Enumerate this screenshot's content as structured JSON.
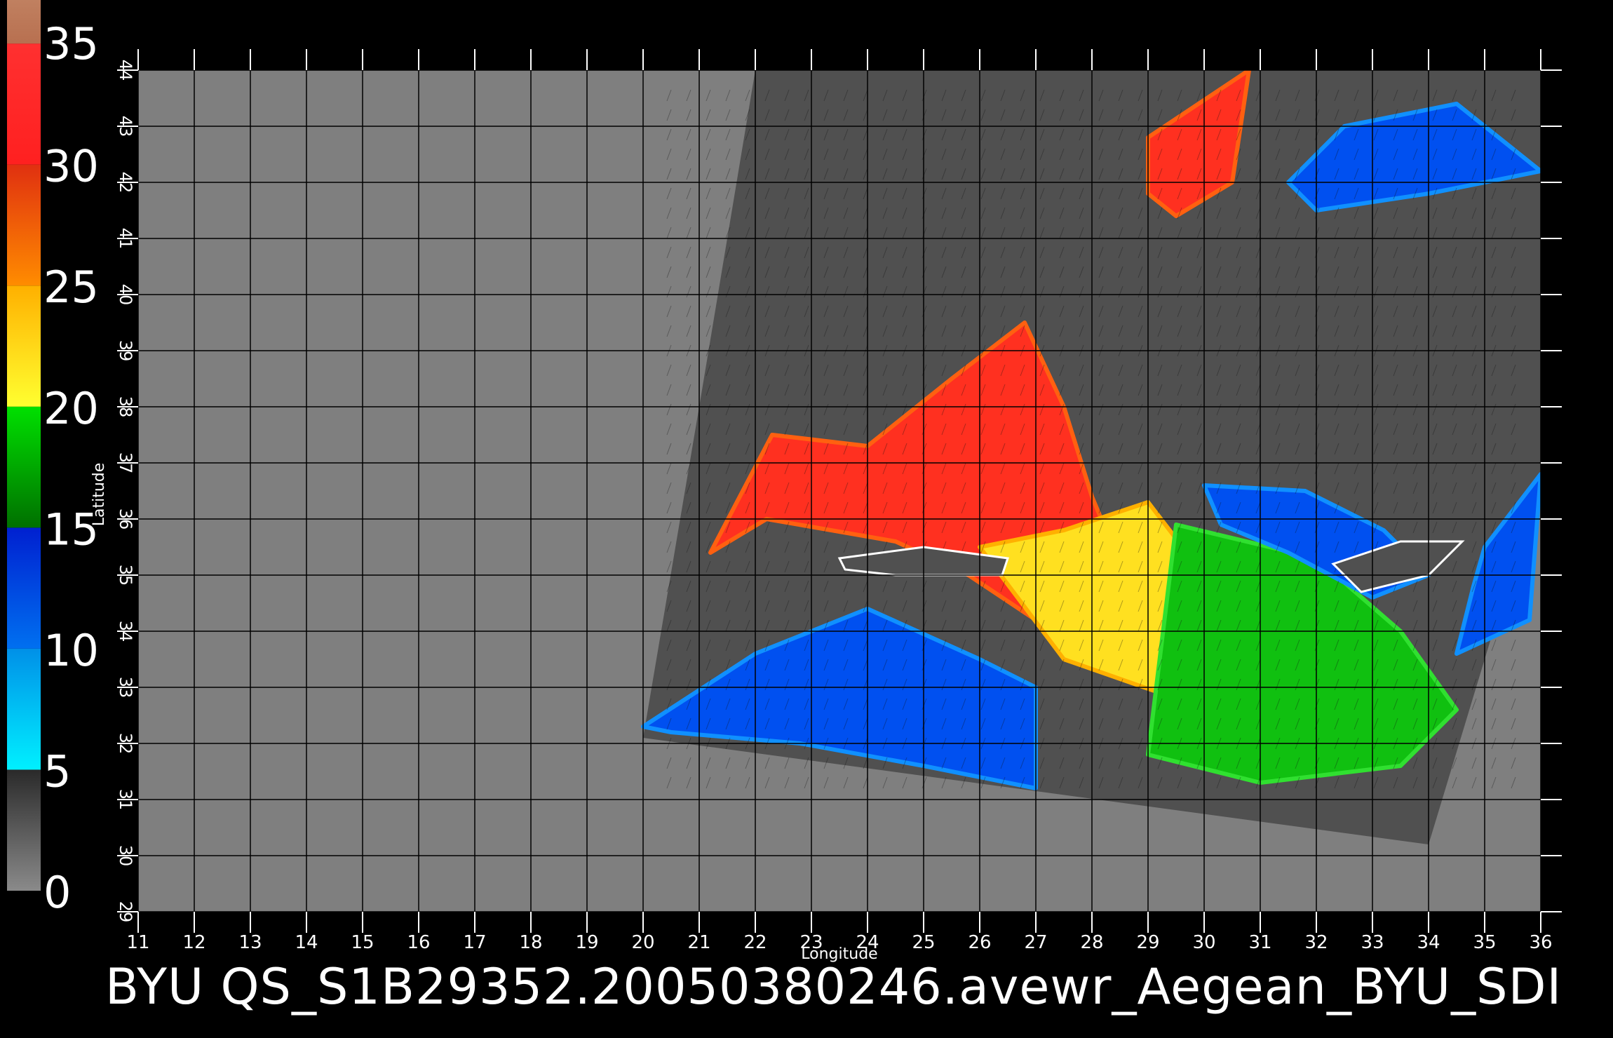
{
  "colorbar": {
    "tick_labels": [
      "0",
      "5",
      "10",
      "15",
      "20",
      "25",
      "30",
      "35"
    ],
    "bands": [
      {
        "from": 0,
        "to": 5,
        "colors": [
          "#8a8a8a",
          "#2a2a2a"
        ]
      },
      {
        "from": 5,
        "to": 10,
        "colors": [
          "#00f0ff",
          "#0090e8"
        ]
      },
      {
        "from": 10,
        "to": 15,
        "colors": [
          "#0070f0",
          "#0020d0"
        ]
      },
      {
        "from": 15,
        "to": 20,
        "colors": [
          "#007000",
          "#00e000"
        ]
      },
      {
        "from": 20,
        "to": 25,
        "colors": [
          "#ffff30",
          "#ffb000"
        ]
      },
      {
        "from": 25,
        "to": 30,
        "colors": [
          "#ff8c00",
          "#e03010"
        ]
      },
      {
        "from": 30,
        "to": 35,
        "colors": [
          "#ff2020",
          "#ff3030"
        ]
      },
      {
        "from": 35,
        "to": 37,
        "colors": [
          "#b87050",
          "#c08060"
        ]
      }
    ]
  },
  "map": {
    "x_axis": {
      "label": "Longitude",
      "min": 11,
      "max": 36,
      "ticks": [
        "11",
        "12",
        "13",
        "14",
        "15",
        "16",
        "17",
        "18",
        "19",
        "20",
        "21",
        "22",
        "23",
        "24",
        "25",
        "26",
        "27",
        "28",
        "29",
        "30",
        "31",
        "32",
        "33",
        "34",
        "35",
        "36"
      ]
    },
    "y_axis": {
      "label": "Latitude",
      "min": 29,
      "max": 44,
      "ticks": [
        "29",
        "30",
        "31",
        "32",
        "33",
        "34",
        "35",
        "36",
        "37",
        "38",
        "39",
        "40",
        "41",
        "42",
        "43",
        "44"
      ]
    },
    "swath_lonlat": [
      [
        22.0,
        44.0
      ],
      [
        36.0,
        44.0
      ],
      [
        36.0,
        36.8
      ],
      [
        34.0,
        30.2
      ],
      [
        20.0,
        32.1
      ],
      [
        21.0,
        38.0
      ]
    ],
    "land_color": "#505050",
    "background_color": "#7f7f7f",
    "wind_regions": [
      {
        "level": "red",
        "lonlat": [
          [
            29.0,
            42.8
          ],
          [
            30.8,
            44.0
          ],
          [
            30.5,
            42.0
          ],
          [
            29.5,
            41.4
          ],
          [
            29.0,
            41.8
          ]
        ]
      },
      {
        "level": "red",
        "lonlat": [
          [
            22.3,
            37.5
          ],
          [
            24.0,
            37.3
          ],
          [
            25.5,
            38.5
          ],
          [
            26.8,
            39.5
          ],
          [
            27.5,
            38.0
          ],
          [
            28.0,
            36.4
          ],
          [
            28.5,
            35.2
          ],
          [
            27.0,
            34.2
          ],
          [
            25.8,
            35.0
          ],
          [
            24.5,
            35.6
          ],
          [
            22.2,
            36.0
          ],
          [
            21.2,
            35.4
          ]
        ]
      },
      {
        "level": "yellow",
        "lonlat": [
          [
            26.0,
            35.5
          ],
          [
            27.5,
            35.8
          ],
          [
            29.0,
            36.3
          ],
          [
            30.0,
            35.0
          ],
          [
            32.0,
            33.0
          ],
          [
            31.5,
            32.0
          ],
          [
            29.5,
            32.8
          ],
          [
            27.5,
            33.5
          ]
        ]
      },
      {
        "level": "green",
        "lonlat": [
          [
            29.5,
            35.9
          ],
          [
            32.0,
            35.3
          ],
          [
            33.5,
            34.0
          ],
          [
            34.5,
            32.6
          ],
          [
            33.5,
            31.6
          ],
          [
            31.0,
            31.3
          ],
          [
            29.0,
            31.8
          ]
        ]
      },
      {
        "level": "blue",
        "lonlat": [
          [
            20.0,
            32.3
          ],
          [
            22.0,
            33.6
          ],
          [
            24.0,
            34.4
          ],
          [
            26.0,
            33.5
          ],
          [
            27.0,
            33.0
          ],
          [
            27.0,
            31.2
          ],
          [
            25.0,
            31.6
          ],
          [
            22.8,
            32.0
          ],
          [
            20.5,
            32.2
          ]
        ]
      },
      {
        "level": "blue",
        "lonlat": [
          [
            30.0,
            36.6
          ],
          [
            31.8,
            36.5
          ],
          [
            33.2,
            35.8
          ],
          [
            34.0,
            35.0
          ],
          [
            33.0,
            34.6
          ],
          [
            31.5,
            35.4
          ],
          [
            30.3,
            35.9
          ]
        ]
      },
      {
        "level": "blue",
        "lonlat": [
          [
            31.5,
            42.0
          ],
          [
            32.5,
            43.0
          ],
          [
            34.5,
            43.4
          ],
          [
            36.0,
            42.2
          ],
          [
            34.0,
            41.8
          ],
          [
            32.0,
            41.5
          ]
        ]
      },
      {
        "level": "blue",
        "lonlat": [
          [
            35.0,
            35.5
          ],
          [
            36.0,
            36.8
          ],
          [
            35.8,
            34.2
          ],
          [
            34.5,
            33.6
          ],
          [
            34.8,
            34.8
          ]
        ]
      }
    ],
    "island_blanks": [
      {
        "lonlat": [
          [
            23.5,
            35.3
          ],
          [
            25.0,
            35.5
          ],
          [
            26.5,
            35.3
          ],
          [
            26.4,
            35.0
          ],
          [
            24.5,
            35.0
          ],
          [
            23.6,
            35.1
          ]
        ]
      },
      {
        "lonlat": [
          [
            32.3,
            35.2
          ],
          [
            33.5,
            35.6
          ],
          [
            34.6,
            35.6
          ],
          [
            34.0,
            35.0
          ],
          [
            32.8,
            34.7
          ]
        ]
      }
    ]
  },
  "caption": "BYU QS_S1B29352.20050380246.avewr_Aegean_BYU_SDI"
}
